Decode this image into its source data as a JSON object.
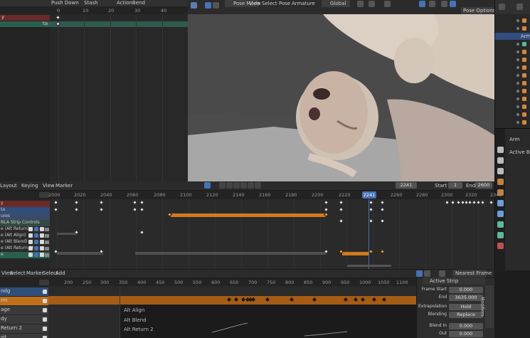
{
  "dopesheet_top": {
    "header_items": [
      "Push Down",
      "Stash",
      "ActionBend"
    ],
    "ruler_ticks": [
      "0",
      "10",
      "20",
      "30",
      "40"
    ],
    "channels": [
      {
        "label": "y",
        "color": "#6a2a2a"
      },
      {
        "label": "ta",
        "color": "#2a5f50"
      }
    ]
  },
  "viewport": {
    "mode": "Pose Mode",
    "menus": [
      "View",
      "Select",
      "Pose",
      "Armature"
    ],
    "orientation_label": "Global",
    "overlay_label": "Pose Options"
  },
  "timeline_bar": {
    "current_frame": "2241",
    "start_label": "Start",
    "start_value": "1",
    "end_label": "End",
    "end_value": "2600"
  },
  "nla": {
    "header_items": [
      "Layout",
      "Keying",
      "View",
      "Marker"
    ],
    "ruler_ticks": [
      "2000",
      "2020",
      "2040",
      "2060",
      "2080",
      "2100",
      "2120",
      "2140",
      "2160",
      "2180",
      "2200",
      "2220",
      "2240",
      "2260",
      "2280",
      "2300",
      "2320",
      "2340"
    ],
    "current_marker": "2241",
    "tracks": [
      {
        "label": "y",
        "color": "#6a2a2a",
        "checkboxes": false
      },
      {
        "label": "ta",
        "color": "#2f4f7a",
        "checkboxes": false
      },
      {
        "label": "ures",
        "color": "#3c4a6a",
        "checkboxes": false
      },
      {
        "label": "NLA Strip Controls",
        "color": "#334a44",
        "checkboxes": false
      },
      {
        "label": "e (Alt Return)",
        "color": "#2a2a2a",
        "checkboxes": true
      },
      {
        "label": "e (Alt Align)",
        "color": "#2a2a2a",
        "checkboxes": true
      },
      {
        "label": "e (Alt Blend)",
        "color": "#2a2a2a",
        "checkboxes": true
      },
      {
        "label": "e (Alt Return 2)",
        "color": "#2a2a2a",
        "checkboxes": true
      },
      {
        "label": "e",
        "color": "#2a5f50",
        "checkboxes": true
      }
    ]
  },
  "graph": {
    "header_items": [
      "View",
      "Select",
      "Marker",
      "Select",
      "Add"
    ],
    "ruler_ticks": [
      "-200",
      "-150",
      "-100",
      "-50",
      "0",
      "50",
      "100",
      "150",
      "200",
      "250",
      "300",
      "350",
      "400",
      "450",
      "500",
      "550",
      "600",
      "650",
      "700",
      "750"
    ],
    "ruler_visible": [
      "200",
      "250",
      "300",
      "350",
      "400",
      "450",
      "500",
      "550",
      "600",
      "650",
      "700",
      "750",
      "800",
      "850",
      "900",
      "950",
      "1000",
      "1050",
      "1100",
      "1150"
    ],
    "rows": [
      {
        "label": "ndg",
        "color": "#2f4f7a"
      },
      {
        "label": "rm",
        "color": "#c0701a"
      },
      {
        "label": "age",
        "color": "#3a3a3a"
      },
      {
        "label": "dy",
        "color": "#3a3a3a"
      },
      {
        "label": "Return 2",
        "color": "#3a3a3a"
      },
      {
        "label": "sit",
        "color": "#3a3a3a"
      }
    ],
    "strip_labels": [
      "Alt Align",
      "Alt Blend",
      "Alt Return 2"
    ],
    "tool_label": "Nearest Frame"
  },
  "strip_panel": {
    "section": "Active Strip",
    "fields": [
      {
        "label": "Frame Start",
        "value": "0.000"
      },
      {
        "label": "End",
        "value": "3635.000"
      },
      {
        "label": "Extrapolation",
        "value": "Hold"
      },
      {
        "label": "Blending",
        "value": "Replace"
      },
      {
        "label": "Blend In",
        "value": "0.000"
      },
      {
        "label": "Out",
        "value": "0.000"
      }
    ],
    "tab_label": "Modifiers"
  },
  "outliner": {
    "items": [
      "Arm",
      "Arm",
      "Arm",
      "Arm",
      "Arm",
      "Arm",
      "Arm",
      "Arm",
      "Arm",
      "Arm",
      "Arm",
      "Arm",
      "Arm",
      "Arm",
      "Arm"
    ]
  },
  "properties": {
    "title": "Arm",
    "subtitle": "Active Bone"
  }
}
